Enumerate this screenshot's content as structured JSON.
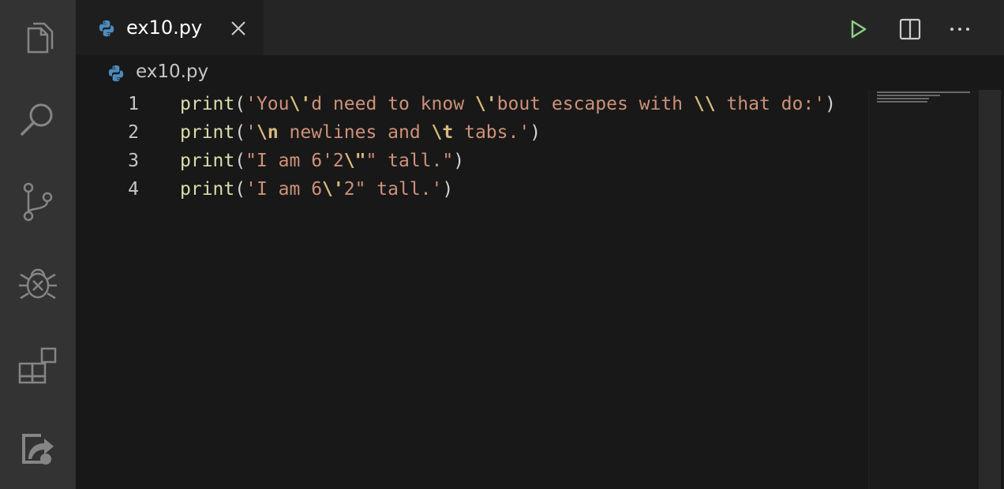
{
  "activity_bar": {
    "icons": [
      "files-icon",
      "search-icon",
      "source-control-icon",
      "run-debug-icon",
      "extensions-icon",
      "remote-explorer-icon"
    ]
  },
  "tab": {
    "label": "ex10.py",
    "icon": "python-icon"
  },
  "toolbar": {
    "run_icon": "play-icon",
    "split_icon": "split-editor-icon",
    "more_icon": "ellipsis-icon"
  },
  "breadcrumb": {
    "label": "ex10.py",
    "icon": "python-icon"
  },
  "editor": {
    "lines": [
      {
        "number": "1",
        "tokens": [
          {
            "t": "fn",
            "v": "print"
          },
          {
            "t": "punc",
            "v": "("
          },
          {
            "t": "str",
            "v": "'You"
          },
          {
            "t": "esc",
            "v": "\\'"
          },
          {
            "t": "str",
            "v": "d need to know "
          },
          {
            "t": "esc",
            "v": "\\'"
          },
          {
            "t": "str",
            "v": "bout escapes with "
          },
          {
            "t": "esc",
            "v": "\\\\"
          },
          {
            "t": "str",
            "v": " that do:'"
          },
          {
            "t": "punc",
            "v": ")"
          }
        ]
      },
      {
        "number": "2",
        "tokens": [
          {
            "t": "fn",
            "v": "print"
          },
          {
            "t": "punc",
            "v": "("
          },
          {
            "t": "str",
            "v": "'"
          },
          {
            "t": "esc",
            "v": "\\n"
          },
          {
            "t": "str",
            "v": " newlines and "
          },
          {
            "t": "esc",
            "v": "\\t"
          },
          {
            "t": "str",
            "v": " tabs.'"
          },
          {
            "t": "punc",
            "v": ")"
          }
        ]
      },
      {
        "number": "3",
        "tokens": [
          {
            "t": "fn",
            "v": "print"
          },
          {
            "t": "punc",
            "v": "("
          },
          {
            "t": "str",
            "v": "\"I am 6'2"
          },
          {
            "t": "esc",
            "v": "\\\""
          },
          {
            "t": "str",
            "v": "\" tall.\""
          },
          {
            "t": "punc",
            "v": ")"
          }
        ]
      },
      {
        "number": "4",
        "tokens": [
          {
            "t": "fn",
            "v": "print"
          },
          {
            "t": "punc",
            "v": "("
          },
          {
            "t": "str",
            "v": "'I am 6"
          },
          {
            "t": "esc",
            "v": "\\'"
          },
          {
            "t": "str",
            "v": "2\" tall.'"
          },
          {
            "t": "punc",
            "v": ")"
          }
        ]
      }
    ]
  },
  "colors": {
    "function": "#dcdcaa",
    "string": "#ce9178",
    "escape": "#d7ba7d",
    "run_button": "#89d185",
    "python_blue": "#4b8bbe"
  }
}
